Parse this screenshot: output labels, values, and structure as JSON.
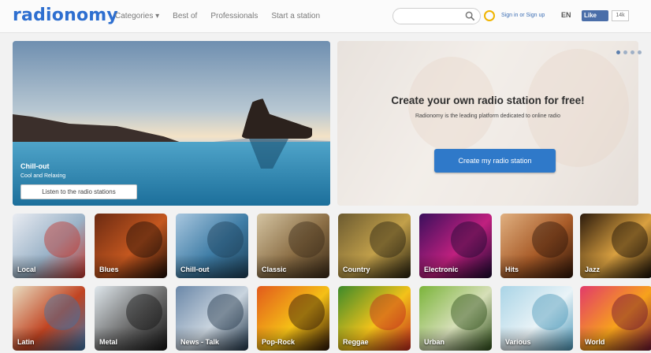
{
  "header": {
    "logo": "radionomy",
    "nav": [
      "Categories ▾",
      "Best of",
      "Professionals",
      "Start a station"
    ],
    "login": "Sign in or Sign up",
    "lang": "EN",
    "fb_like": "Like",
    "fb_count": "14k"
  },
  "hero_left": {
    "title": "Chill-out",
    "subtitle": "Cool and Relaxing",
    "button": "Listen to the radio stations"
  },
  "hero_right": {
    "title": "Create your own radio station for free!",
    "subtitle": "Radionomy is the leading platform dedicated to online radio",
    "button": "Create my radio station"
  },
  "genres_row1": [
    {
      "label": "Local",
      "colors": [
        "#e9ecf2",
        "#9ab2c7",
        "#c2342a"
      ]
    },
    {
      "label": "Blues",
      "colors": [
        "#6b2a12",
        "#c4571f",
        "#1c0d06"
      ]
    },
    {
      "label": "Chill-out",
      "colors": [
        "#a9c7df",
        "#3f7da6",
        "#1d3f56"
      ]
    },
    {
      "label": "Classic",
      "colors": [
        "#d4c4a2",
        "#8c6f46",
        "#3a2a18"
      ]
    },
    {
      "label": "Country",
      "colors": [
        "#6b5a30",
        "#c2a04a",
        "#26200f"
      ]
    },
    {
      "label": "Electronic",
      "colors": [
        "#3a0f5c",
        "#c0207f",
        "#1a0830"
      ]
    },
    {
      "label": "Hits",
      "colors": [
        "#e0b080",
        "#a85b28",
        "#2d1408"
      ]
    },
    {
      "label": "Jazz",
      "colors": [
        "#2b1a0c",
        "#d9a040",
        "#130b05"
      ]
    }
  ],
  "genres_row2": [
    {
      "label": "Latin",
      "colors": [
        "#e8dcc0",
        "#c14422",
        "#3b73a8"
      ]
    },
    {
      "label": "Metal",
      "colors": [
        "#dfe7ec",
        "#6b6b6b",
        "#141414"
      ]
    },
    {
      "label": "News - Talk",
      "colors": [
        "#6a87a8",
        "#c9d4de",
        "#1f3448"
      ]
    },
    {
      "label": "Pop-Rock",
      "colors": [
        "#e25a1c",
        "#f5c016",
        "#2a1206"
      ]
    },
    {
      "label": "Reggae",
      "colors": [
        "#3c8a2a",
        "#f3c21a",
        "#c2261c"
      ]
    },
    {
      "label": "Urban",
      "colors": [
        "#7bb43a",
        "#d6dfb8",
        "#2d4d18"
      ]
    },
    {
      "label": "Various",
      "colors": [
        "#a9d4e6",
        "#e9f3f7",
        "#4a97b8"
      ]
    },
    {
      "label": "World",
      "colors": [
        "#e23a6a",
        "#f7a21c",
        "#6a1030"
      ]
    }
  ]
}
